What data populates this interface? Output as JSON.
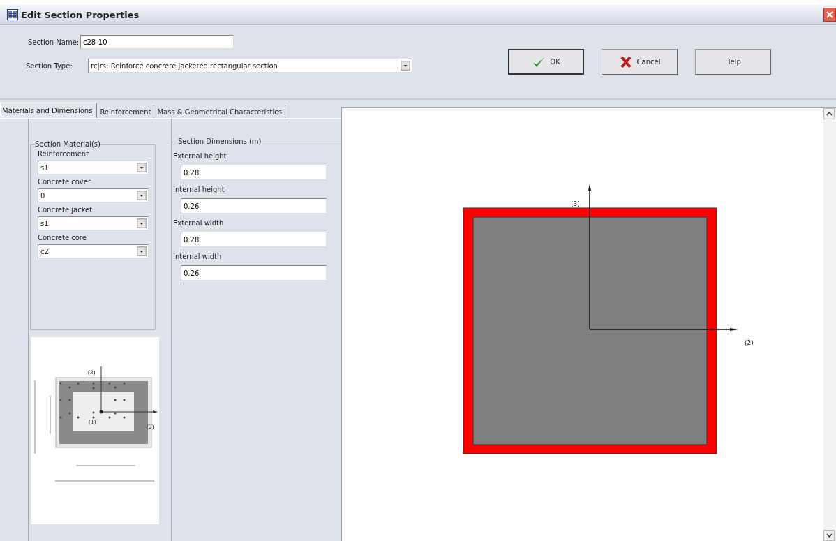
{
  "window": {
    "title": "Edit Section Properties"
  },
  "section_name": {
    "label": "Section Name:",
    "value": "c28-10"
  },
  "section_type": {
    "label": "Section Type:",
    "value": "rc|rs: Reinforce concrete jacketed rectangular section"
  },
  "buttons": [
    {
      "kind": "ok",
      "label": "OK"
    },
    {
      "kind": "cancel",
      "label": "Cancel"
    },
    {
      "kind": "help",
      "label": "Help"
    }
  ],
  "tabs": [
    {
      "label": "Materials and Dimensions",
      "selected": true
    },
    {
      "label": "Reinforcement",
      "selected": false
    },
    {
      "label": "Mass & Geometrical Characteristics",
      "selected": false
    }
  ],
  "materials": {
    "title": "Section Material(s)",
    "items": [
      {
        "label": "Reinforcement",
        "value": "s1"
      },
      {
        "label": "Concrete cover",
        "value": "0"
      },
      {
        "label": "Concrete jacket",
        "value": "s1"
      },
      {
        "label": "Concrete core",
        "value": "c2"
      }
    ]
  },
  "preview": {
    "labels": [
      "(3)",
      "(1)",
      "(2)"
    ]
  },
  "dimensions": {
    "title": "Section Dimensions (m)",
    "items": [
      {
        "label": "External height",
        "value": "0.28"
      },
      {
        "label": "Internal height",
        "value": "0.26"
      },
      {
        "label": "External width",
        "value": "0.28"
      },
      {
        "label": "Internal width",
        "value": "0.26"
      }
    ]
  },
  "canvas": {
    "axis_labels": [
      "(3)",
      "(2)"
    ]
  }
}
